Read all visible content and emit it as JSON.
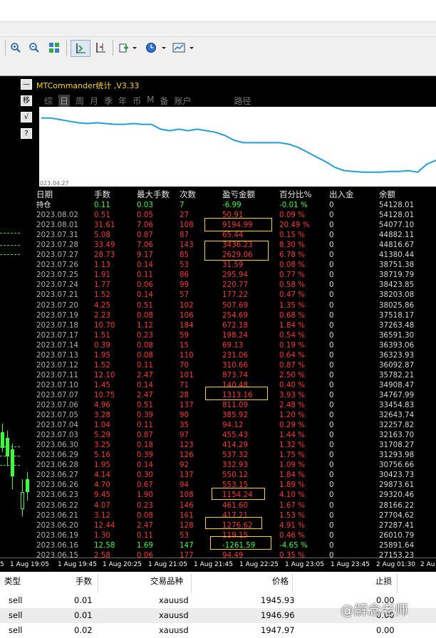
{
  "panel": {
    "title": "MTCommander统计 ,V3.33",
    "tabs": [
      "综",
      "日",
      "周",
      "月",
      "季",
      "年",
      "币",
      "M",
      "备",
      "账户",
      "路径"
    ],
    "active_tab": "日",
    "graph_date": "023.04.27"
  },
  "sidebar_buttons": [
    "—",
    "移",
    "√",
    "?"
  ],
  "table": {
    "headers": [
      "日期",
      "手数",
      "最大手数",
      "次数",
      "盈亏金额",
      "百分比%",
      "出入金",
      "余额"
    ],
    "rows": [
      {
        "date": "持仓",
        "lots": "0.11",
        "max": "0.03",
        "count": "7",
        "pnl": "-6.99",
        "pct": "-0.01 %",
        "io": "0",
        "bal": "54128.01",
        "color": "green"
      },
      {
        "date": "2023.08.02",
        "lots": "0.51",
        "max": "0.05",
        "count": "27",
        "pnl": "50.91",
        "pct": "0.09 %",
        "io": "0",
        "bal": "54128.01",
        "color": "red"
      },
      {
        "date": "2023.08.01",
        "lots": "31.61",
        "max": "7.06",
        "count": "108",
        "pnl": "9194.99",
        "pct": "20.49 %",
        "io": "0",
        "bal": "54077.10",
        "color": "red"
      },
      {
        "date": "2023.07.31",
        "lots": "5.08",
        "max": "0.87",
        "count": "87",
        "pnl": "65.44",
        "pct": "0.15 %",
        "io": "0",
        "bal": "44882.11",
        "color": "red"
      },
      {
        "date": "2023.07.28",
        "lots": "33.49",
        "max": "7.06",
        "count": "143",
        "pnl": "3436.23",
        "pct": "8.30 %",
        "io": "0",
        "bal": "44816.67",
        "color": "red"
      },
      {
        "date": "2023.07.27",
        "lots": "28.73",
        "max": "9.17",
        "count": "85",
        "pnl": "2629.06",
        "pct": "6.78 %",
        "io": "0",
        "bal": "41380.44",
        "color": "red"
      },
      {
        "date": "2023.07.26",
        "lots": "1.13",
        "max": "0.14",
        "count": "53",
        "pnl": "31.59",
        "pct": "0.08 %",
        "io": "0",
        "bal": "38751.38",
        "color": "red"
      },
      {
        "date": "2023.07.25",
        "lots": "1.91",
        "max": "0.11",
        "count": "86",
        "pnl": "295.94",
        "pct": "0.77 %",
        "io": "0",
        "bal": "38719.79",
        "color": "red"
      },
      {
        "date": "2023.07.24",
        "lots": "1.77",
        "max": "0.06",
        "count": "99",
        "pnl": "220.77",
        "pct": "0.58 %",
        "io": "0",
        "bal": "38423.85",
        "color": "red"
      },
      {
        "date": "2023.07.21",
        "lots": "1.52",
        "max": "0.14",
        "count": "57",
        "pnl": "177.22",
        "pct": "0.47 %",
        "io": "0",
        "bal": "38203.08",
        "color": "red"
      },
      {
        "date": "2023.07.20",
        "lots": "4.25",
        "max": "0.51",
        "count": "102",
        "pnl": "507.69",
        "pct": "1.35 %",
        "io": "0",
        "bal": "38025.86",
        "color": "red"
      },
      {
        "date": "2023.07.19",
        "lots": "2.23",
        "max": "0.08",
        "count": "106",
        "pnl": "254.69",
        "pct": "0.68 %",
        "io": "0",
        "bal": "37518.17",
        "color": "red"
      },
      {
        "date": "2023.07.18",
        "lots": "10.70",
        "max": "1.12",
        "count": "184",
        "pnl": "672.18",
        "pct": "1.84 %",
        "io": "0",
        "bal": "37263.48",
        "color": "red"
      },
      {
        "date": "2023.07.17",
        "lots": "1.51",
        "max": "0.23",
        "count": "59",
        "pnl": "198.24",
        "pct": "0.54 %",
        "io": "0",
        "bal": "36591.30",
        "color": "red"
      },
      {
        "date": "2023.07.14",
        "lots": "0.39",
        "max": "0.08",
        "count": "15",
        "pnl": "69.13",
        "pct": "0.19 %",
        "io": "0",
        "bal": "36393.06",
        "color": "red"
      },
      {
        "date": "2023.07.13",
        "lots": "1.95",
        "max": "0.08",
        "count": "110",
        "pnl": "231.06",
        "pct": "0.64 %",
        "io": "0",
        "bal": "36323.93",
        "color": "red"
      },
      {
        "date": "2023.07.12",
        "lots": "1.52",
        "max": "0.11",
        "count": "70",
        "pnl": "310.66",
        "pct": "0.87 %",
        "io": "0",
        "bal": "36092.87",
        "color": "red"
      },
      {
        "date": "2023.07.11",
        "lots": "12.10",
        "max": "2.47",
        "count": "101",
        "pnl": "873.74",
        "pct": "2.50 %",
        "io": "0",
        "bal": "35782.21",
        "color": "red"
      },
      {
        "date": "2023.07.10",
        "lots": "1.45",
        "max": "0.14",
        "count": "71",
        "pnl": "140.48",
        "pct": "0.40 %",
        "io": "0",
        "bal": "34908.47",
        "color": "red"
      },
      {
        "date": "2023.07.07",
        "lots": "10.75",
        "max": "2.47",
        "count": "28",
        "pnl": "1313.16",
        "pct": "3.93 %",
        "io": "0",
        "bal": "34767.99",
        "color": "red"
      },
      {
        "date": "2023.07.06",
        "lots": "4.96",
        "max": "0.51",
        "count": "137",
        "pnl": "811.09",
        "pct": "2.48 %",
        "io": "0",
        "bal": "33454.83",
        "color": "red"
      },
      {
        "date": "2023.07.05",
        "lots": "3.28",
        "max": "0.39",
        "count": "90",
        "pnl": "385.92",
        "pct": "1.20 %",
        "io": "0",
        "bal": "32643.74",
        "color": "red"
      },
      {
        "date": "2023.07.04",
        "lots": "1.04",
        "max": "0.11",
        "count": "35",
        "pnl": "94.12",
        "pct": "0.29 %",
        "io": "0",
        "bal": "32257.82",
        "color": "red"
      },
      {
        "date": "2023.07.03",
        "lots": "5.29",
        "max": "0.87",
        "count": "97",
        "pnl": "455.43",
        "pct": "1.44 %",
        "io": "0",
        "bal": "32163.70",
        "color": "red"
      },
      {
        "date": "2023.06.30",
        "lots": "3.25",
        "max": "0.18",
        "count": "123",
        "pnl": "414.29",
        "pct": "1.32 %",
        "io": "0",
        "bal": "31708.27",
        "color": "red"
      },
      {
        "date": "2023.06.29",
        "lots": "5.16",
        "max": "0.39",
        "count": "126",
        "pnl": "537.32",
        "pct": "1.75 %",
        "io": "0",
        "bal": "31293.98",
        "color": "red"
      },
      {
        "date": "2023.06.28",
        "lots": "1.95",
        "max": "0.14",
        "count": "92",
        "pnl": "332.93",
        "pct": "1.09 %",
        "io": "0",
        "bal": "30756.66",
        "color": "red"
      },
      {
        "date": "2023.06.27",
        "lots": "4.14",
        "max": "0.30",
        "count": "137",
        "pnl": "550.12",
        "pct": "1.84 %",
        "io": "0",
        "bal": "30423.73",
        "color": "red"
      },
      {
        "date": "2023.06.26",
        "lots": "4.70",
        "max": "0.67",
        "count": "94",
        "pnl": "553.15",
        "pct": "1.89 %",
        "io": "0",
        "bal": "29873.61",
        "color": "red"
      },
      {
        "date": "2023.06.23",
        "lots": "9.45",
        "max": "1.90",
        "count": "108",
        "pnl": "1154.24",
        "pct": "4.10 %",
        "io": "0",
        "bal": "29320.46",
        "color": "red"
      },
      {
        "date": "2023.06.22",
        "lots": "4.07",
        "max": "0.23",
        "count": "146",
        "pnl": "461.60",
        "pct": "1.67 %",
        "io": "0",
        "bal": "28166.22",
        "color": "red"
      },
      {
        "date": "2023.06.21",
        "lots": "3.12",
        "max": "0.08",
        "count": "161",
        "pnl": "417.21",
        "pct": "1.53 %",
        "io": "0",
        "bal": "27704.62",
        "color": "red"
      },
      {
        "date": "2023.06.20",
        "lots": "12.44",
        "max": "2.47",
        "count": "128",
        "pnl": "1276.62",
        "pct": "4.91 %",
        "io": "0",
        "bal": "27287.41",
        "color": "red"
      },
      {
        "date": "2023.06.19",
        "lots": "1.30",
        "max": "0.11",
        "count": "53",
        "pnl": "119.15",
        "pct": "0.46 %",
        "io": "0",
        "bal": "26010.79",
        "color": "red"
      },
      {
        "date": "2023.06.16",
        "lots": "12.58",
        "max": "1.69",
        "count": "147",
        "pnl": "-1261.59",
        "pct": "-4.65 %",
        "io": "0",
        "bal": "25891.64",
        "color": "green"
      },
      {
        "date": "2023.06.15",
        "lots": "2.58",
        "max": "0.06",
        "count": "177",
        "pnl": "94.49",
        "pct": "0.35 %",
        "io": "0",
        "bal": "27153.23",
        "color": "red"
      }
    ]
  },
  "time_axis": [
    "1 Aug 19:05",
    "1 Aug 19:45",
    "1 Aug 20:25",
    "1 Aug 21:05",
    "1 Aug 21:45",
    "1 Aug 22:25",
    "1 Aug 23:05",
    "1 Aug 23:45",
    "2 Aug 01:30",
    "2 Au"
  ],
  "time_axis_lead": "5",
  "orders": {
    "headers": [
      "类型",
      "手数",
      "交易品种",
      "价格",
      "止损"
    ],
    "rows": [
      {
        "type": "sell",
        "lots": "0.01",
        "symbol": "xauusd",
        "price": "1945.93",
        "sl": "0.00"
      },
      {
        "type": "sell",
        "lots": "0.01",
        "symbol": "xauusd",
        "price": "1946.96",
        "sl": "0.00"
      },
      {
        "type": "sell",
        "lots": "0.02",
        "symbol": "xauusd",
        "price": "1947.97",
        "sl": "0.00"
      }
    ]
  },
  "watermark": "@解念老师",
  "colors": {
    "red": "#ff3030",
    "green": "#32ff32",
    "gold": "#ffd700",
    "curve": "#1e9fe0"
  },
  "equity_curve": [
    0.86,
    0.86,
    0.84,
    0.82,
    0.8,
    0.79,
    0.8,
    0.79,
    0.78,
    0.78,
    0.79,
    0.78,
    0.78,
    0.72,
    0.7,
    0.72,
    0.7,
    0.72,
    0.7,
    0.68,
    0.64,
    0.58,
    0.55,
    0.55,
    0.55,
    0.55,
    0.55,
    0.53,
    0.49,
    0.43,
    0.37,
    0.31,
    0.24,
    0.2,
    0.19,
    0.18,
    0.18,
    0.18,
    0.19,
    0.19,
    0.2,
    0.18,
    0.28,
    0.33
  ]
}
